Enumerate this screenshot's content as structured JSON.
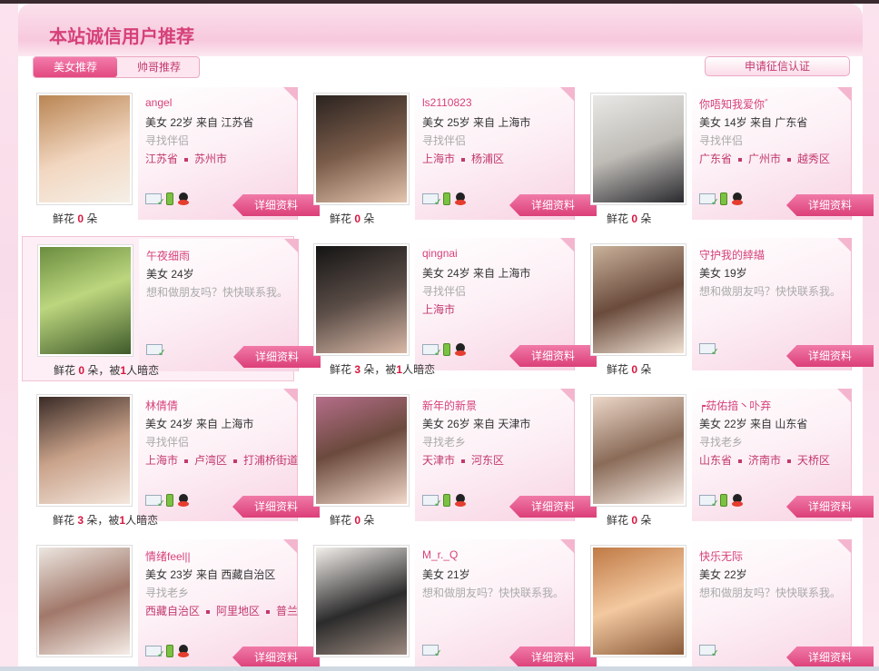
{
  "panel": {
    "title": "本站诚信用户推荐",
    "tabs": [
      {
        "label": "美女推荐",
        "active": true
      },
      {
        "label": "帅哥推荐",
        "active": false
      }
    ],
    "verify_button": "申请征信认证"
  },
  "colors": {
    "accent": "#d6417a",
    "button": "#e2497f",
    "flower_count": "#d6173f"
  },
  "labels": {
    "detail": "详细资料",
    "flower_prefix": "鲜花",
    "flower_unit": "朵",
    "secret_prefix": "，被",
    "secret_suffix": "人暗恋"
  },
  "cards": [
    {
      "name": "angel",
      "line1": "美女 22岁 来自 江苏省",
      "line2": "寻找伴侣",
      "locs": [
        "江苏省",
        "苏州市"
      ],
      "flowers": "0",
      "secret": null,
      "icons": [
        "mail",
        "phone",
        "qq"
      ]
    },
    {
      "name": "ls2110823",
      "line1": "美女 25岁 来自 上海市",
      "line2": "寻找伴侣",
      "locs": [
        "上海市",
        "杨浦区"
      ],
      "flowers": "0",
      "secret": null,
      "icons": [
        "mail",
        "phone",
        "qq"
      ]
    },
    {
      "name": "你唔知我爱你゛",
      "line1": "美女 14岁 来自 广东省",
      "line2": "寻找伴侣",
      "locs": [
        "广东省",
        "广州市",
        "越秀区"
      ],
      "flowers": "0",
      "secret": null,
      "icons": [
        "mail",
        "phone",
        "qq"
      ]
    },
    {
      "name": "午夜细雨",
      "line1": "美女 24岁",
      "line2": "想和做朋友吗？快快联系我。",
      "locs": [],
      "flowers": "0",
      "secret": "1",
      "icons": [
        "mail"
      ]
    },
    {
      "name": "qingnai",
      "line1": "美女 24岁 来自 上海市",
      "line2": "寻找伴侣",
      "locs": [
        "上海市"
      ],
      "flowers": "3",
      "secret": "1",
      "icons": [
        "mail",
        "phone",
        "qq"
      ]
    },
    {
      "name": "守护我的緈緢",
      "line1": "美女 19岁",
      "line2": "想和做朋友吗？快快联系我。",
      "locs": [],
      "flowers": "0",
      "secret": null,
      "icons": [
        "mail"
      ]
    },
    {
      "name": "林倩倩",
      "line1": "美女 24岁 来自 上海市",
      "line2": "寻找伴侣",
      "locs": [
        "上海市",
        "卢湾区",
        "打浦桥街道"
      ],
      "flowers": "3",
      "secret": "1",
      "icons": [
        "mail",
        "phone",
        "qq"
      ]
    },
    {
      "name": "新年的新景",
      "line1": "美女 26岁 来自 天津市",
      "line2": "寻找老乡",
      "locs": [
        "天津市",
        "河东区"
      ],
      "flowers": "0",
      "secret": null,
      "icons": [
        "mail",
        "phone",
        "qq"
      ]
    },
    {
      "name": "┍苭佑揞丶卟弃",
      "line1": "美女 22岁 来自 山东省",
      "line2": "寻找老乡",
      "locs": [
        "山东省",
        "济南市",
        "天桥区"
      ],
      "flowers": "0",
      "secret": null,
      "icons": [
        "mail",
        "phone",
        "qq"
      ]
    },
    {
      "name": "情绪feel||",
      "line1": "美女 23岁 来自 西藏自治区",
      "line2": "寻找老乡",
      "locs": [
        "西藏自治区",
        "阿里地区",
        "普兰"
      ],
      "flowers": null,
      "secret": null,
      "icons": [
        "mail",
        "phone",
        "qq"
      ]
    },
    {
      "name": "M_r._Q",
      "line1": "美女 21岁",
      "line2": "想和做朋友吗？快快联系我。",
      "locs": [],
      "flowers": null,
      "secret": null,
      "icons": [
        "mail"
      ]
    },
    {
      "name": "快乐无际",
      "line1": "美女 22岁",
      "line2": "想和做朋友吗？快快联系我。",
      "locs": [],
      "flowers": null,
      "secret": null,
      "icons": [
        "mail"
      ]
    }
  ]
}
